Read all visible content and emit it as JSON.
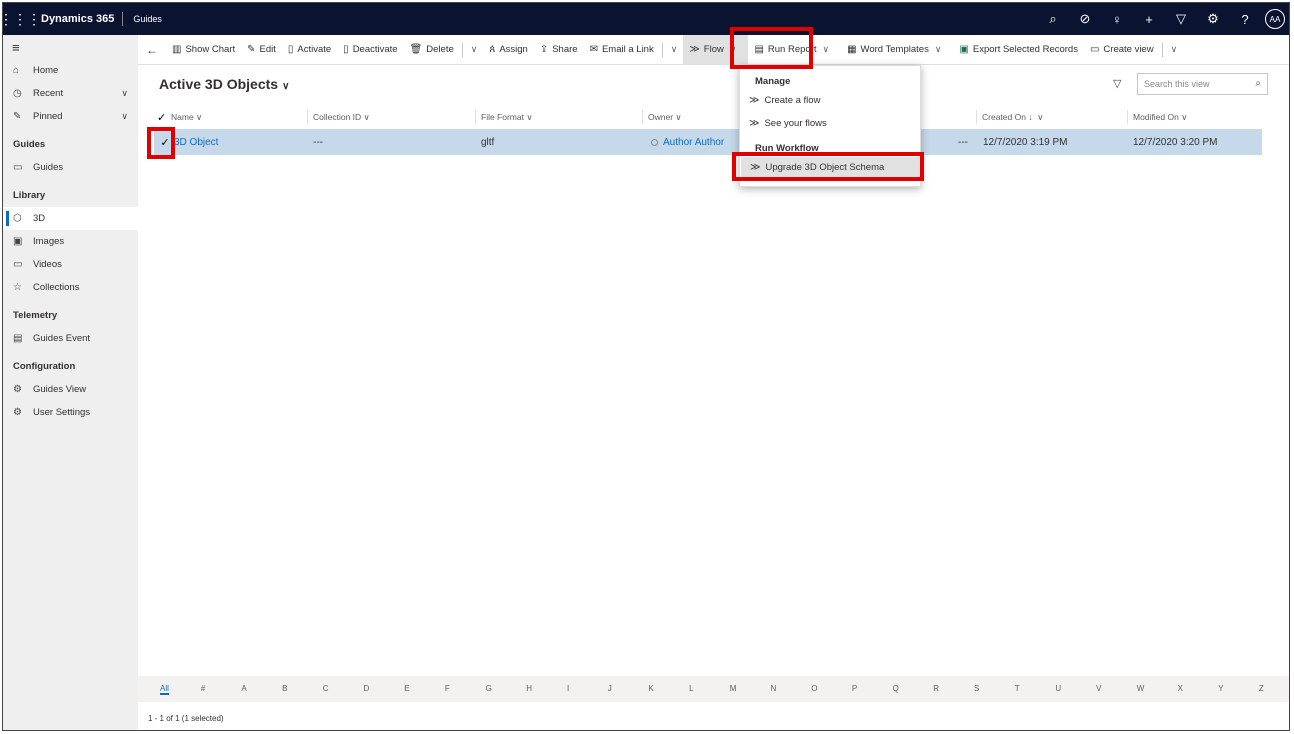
{
  "topbar": {
    "brand": "Dynamics 365",
    "app": "Guides",
    "icons": [
      "search-icon",
      "task-icon",
      "lightbulb-icon",
      "plus-icon",
      "filter-icon",
      "gear-icon",
      "help-icon"
    ],
    "avatar": "AA"
  },
  "sidebar": {
    "home": "Home",
    "recent": "Recent",
    "pinned": "Pinned",
    "groups": {
      "guides": "Guides",
      "library": "Library",
      "telemetry": "Telemetry",
      "configuration": "Configuration"
    },
    "items": {
      "guides": "Guides",
      "threeD": "3D",
      "images": "Images",
      "videos": "Videos",
      "collections": "Collections",
      "guides_event": "Guides Event",
      "guides_view": "Guides View",
      "user_settings": "User Settings"
    }
  },
  "toolbar": {
    "show_chart": "Show Chart",
    "edit": "Edit",
    "activate": "Activate",
    "deactivate": "Deactivate",
    "delete": "Delete",
    "assign": "Assign",
    "share": "Share",
    "email_link": "Email a Link",
    "flow": "Flow",
    "run_report": "Run Report",
    "word_templates": "Word Templates",
    "export": "Export Selected Records",
    "create_view": "Create view"
  },
  "view": {
    "title": "Active 3D Objects",
    "search_placeholder": "Search this view"
  },
  "columns": {
    "name": "Name",
    "collection_id": "Collection ID",
    "file_format": "File Format",
    "owner": "Owner",
    "created_on": "Created On",
    "modified_on": "Modified On"
  },
  "row": {
    "name": "3D Object",
    "collection_id": "---",
    "file_format": "gltf",
    "owner": "Author Author",
    "extra": "---",
    "created_on": "12/7/2020 3:19 PM",
    "modified_on": "12/7/2020 3:20 PM"
  },
  "flow_menu": {
    "manage": "Manage",
    "create_flow": "Create a flow",
    "see_flows": "See your flows",
    "run_workflow": "Run Workflow",
    "upgrade": "Upgrade 3D Object Schema"
  },
  "alphabet": [
    "All",
    "#",
    "A",
    "B",
    "C",
    "D",
    "E",
    "F",
    "G",
    "H",
    "I",
    "J",
    "K",
    "L",
    "M",
    "N",
    "O",
    "P",
    "Q",
    "R",
    "S",
    "T",
    "U",
    "V",
    "W",
    "X",
    "Y",
    "Z"
  ],
  "footer": "1 - 1 of 1 (1 selected)"
}
